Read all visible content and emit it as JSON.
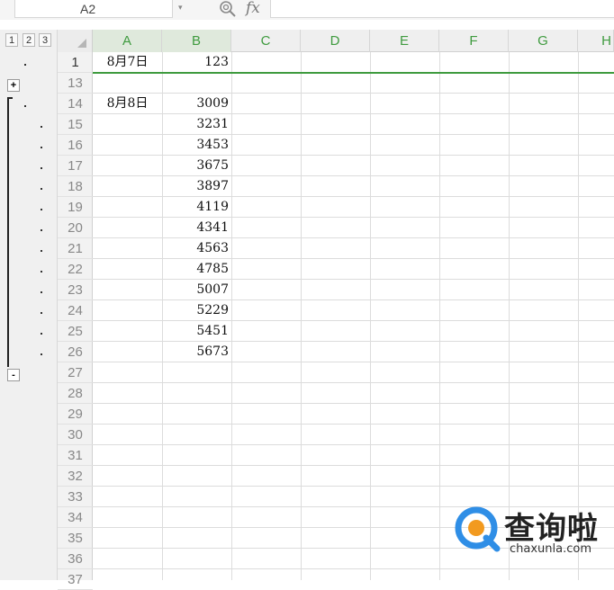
{
  "formula_bar": {
    "name_box": "A2",
    "fx_label": "fx",
    "formula_value": ""
  },
  "outline": {
    "levels": [
      "1",
      "2",
      "3"
    ],
    "expand_label": "+",
    "collapse_label": "-"
  },
  "columns": [
    "A",
    "B",
    "C",
    "D",
    "E",
    "F",
    "G",
    "H"
  ],
  "rows": [
    {
      "num": "1",
      "a": "8月7日",
      "b": "123"
    },
    {
      "num": "13",
      "a": "",
      "b": ""
    },
    {
      "num": "14",
      "a": "8月8日",
      "b": "3009"
    },
    {
      "num": "15",
      "a": "",
      "b": "3231"
    },
    {
      "num": "16",
      "a": "",
      "b": "3453"
    },
    {
      "num": "17",
      "a": "",
      "b": "3675"
    },
    {
      "num": "18",
      "a": "",
      "b": "3897"
    },
    {
      "num": "19",
      "a": "",
      "b": "4119"
    },
    {
      "num": "20",
      "a": "",
      "b": "4341"
    },
    {
      "num": "21",
      "a": "",
      "b": "4563"
    },
    {
      "num": "22",
      "a": "",
      "b": "4785"
    },
    {
      "num": "23",
      "a": "",
      "b": "5007"
    },
    {
      "num": "24",
      "a": "",
      "b": "5229"
    },
    {
      "num": "25",
      "a": "",
      "b": "5451"
    },
    {
      "num": "26",
      "a": "",
      "b": "5673"
    },
    {
      "num": "27",
      "a": "",
      "b": ""
    },
    {
      "num": "28",
      "a": "",
      "b": ""
    },
    {
      "num": "29",
      "a": "",
      "b": ""
    },
    {
      "num": "30",
      "a": "",
      "b": ""
    },
    {
      "num": "31",
      "a": "",
      "b": ""
    },
    {
      "num": "32",
      "a": "",
      "b": ""
    },
    {
      "num": "33",
      "a": "",
      "b": ""
    },
    {
      "num": "34",
      "a": "",
      "b": ""
    },
    {
      "num": "35",
      "a": "",
      "b": ""
    },
    {
      "num": "36",
      "a": "",
      "b": ""
    },
    {
      "num": "37",
      "a": "",
      "b": ""
    }
  ],
  "watermark": {
    "title": "查询啦",
    "subtitle": "chaxunla.com",
    "accent_color": "#2f8ee6",
    "accent_color_2": "#f29a1f"
  },
  "colors": {
    "header_green": "#3f9b3f",
    "grid_line": "#dcdcdc"
  }
}
